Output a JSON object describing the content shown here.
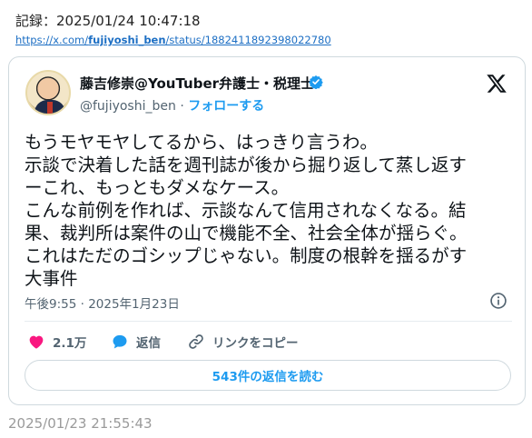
{
  "record": {
    "label": "記録：2025/01/24 10:47:18",
    "url_prefix": "https://x.com/",
    "url_user": "fujiyoshi_ben",
    "url_suffix": "/status/1882411892398022780"
  },
  "tweet": {
    "author_name": "藤吉修崇@YouTuber弁護士・税理士",
    "handle": "@fujiyoshi_ben",
    "separator": " · ",
    "follow_label": "フォローする",
    "text_lines": [
      "もうモヤモヤしてるから、はっきり言うわ。",
      "示談で決着した話を週刊誌が後から掘り返して蒸し返す",
      "ーこれ、もっともダメなケース。",
      "こんな前例を作れば、示談なんて信用されなくなる。結",
      "果、裁判所は案件の山で機能不全、社会全体が揺らぐ。",
      "これはただのゴシップじゃない。制度の根幹を揺るがす",
      "大事件"
    ],
    "timestamp": "午後9:55 · 2025年1月23日",
    "actions": {
      "like_count": "2.1万",
      "reply_label": "返信",
      "copy_link_label": "リンクをコピー"
    },
    "read_replies_label": "543件の返信を読む"
  },
  "footer_date": "2025/01/23 21:55:43",
  "colors": {
    "link_blue": "#1d9bf0",
    "like_pink": "#f91880",
    "verified_blue": "#1d9bf0",
    "muted_text": "#536471"
  },
  "icons": [
    "verified-badge-icon",
    "x-logo-icon",
    "info-icon",
    "heart-icon",
    "reply-bubble-icon",
    "link-icon"
  ]
}
